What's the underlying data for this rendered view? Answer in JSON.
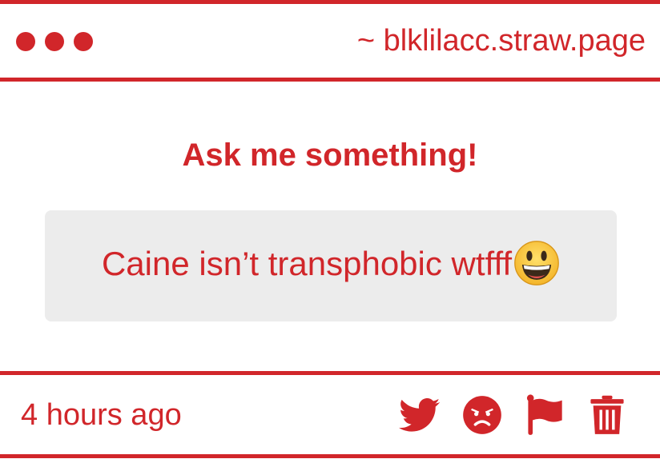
{
  "header": {
    "url": "~ blklilacc.straw.page"
  },
  "main": {
    "title": "Ask me something!",
    "question": "Caine isn’t transphobic wtfff"
  },
  "footer": {
    "timestamp": "4 hours ago"
  },
  "icons": [
    "twitter-icon",
    "angry-face-icon",
    "flag-icon",
    "trash-icon"
  ],
  "colors": {
    "accent": "#d1262a",
    "question_background": "#ececec"
  }
}
